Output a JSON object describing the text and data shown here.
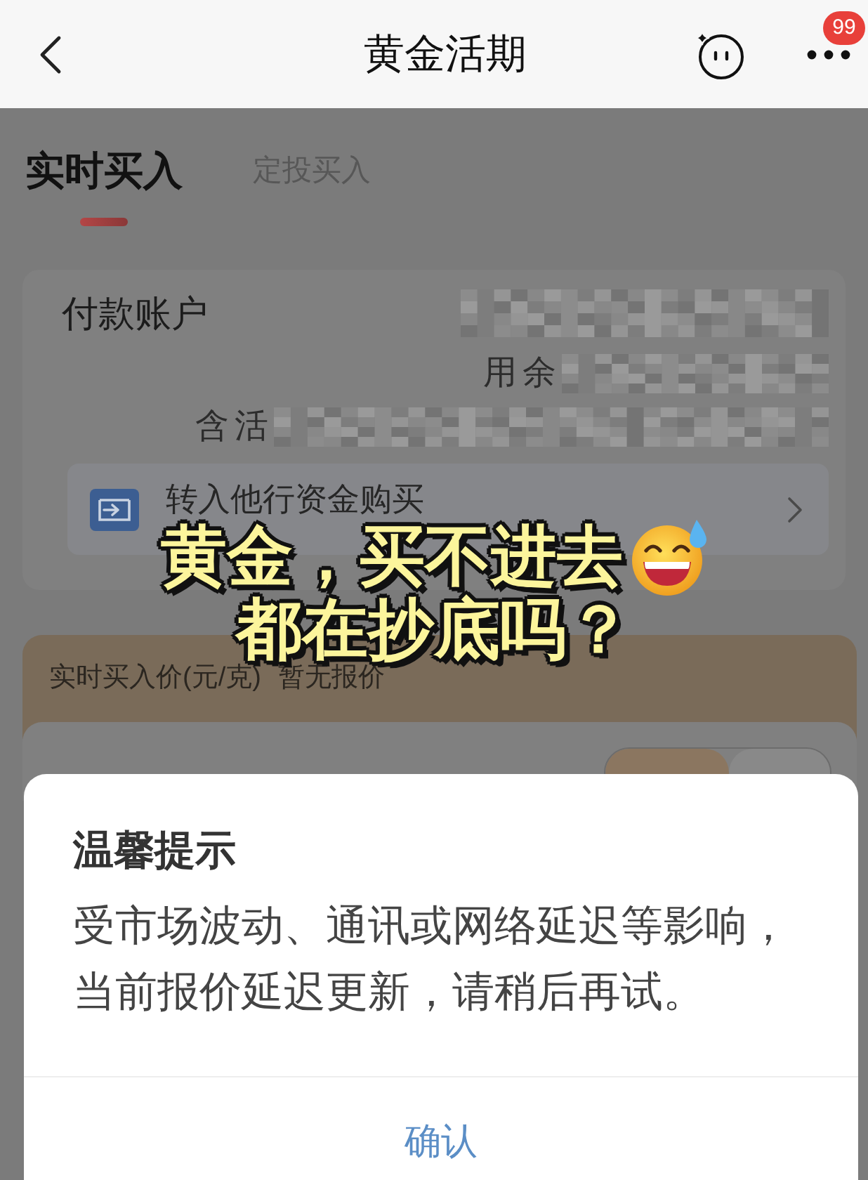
{
  "header": {
    "title": "黄金活期",
    "badge": "99"
  },
  "tabs": [
    {
      "label": "实时买入",
      "selected": true
    },
    {
      "label": "定投买入",
      "selected": false
    }
  ],
  "account": {
    "label": "付款账户",
    "lines": [
      {
        "redacted": true
      },
      {
        "text": "用余",
        "redacted": true
      },
      {
        "text": "含活",
        "redacted": true
      }
    ]
  },
  "transfer": {
    "label": "转入他行资金购买"
  },
  "price": {
    "label": "实时买入价(元/克)",
    "value": "暂无报价"
  },
  "amount": {
    "modes": [
      {
        "selected": true
      },
      {
        "selected": false
      }
    ]
  },
  "caption": {
    "lines": [
      "黄金，买不进去",
      "都在抄底吗？"
    ]
  },
  "dialog": {
    "title": "温馨提示",
    "message": "受市场波动、通讯或网络延迟等影响，当前报价延迟更新，请稍后再试。",
    "button": "确认"
  }
}
